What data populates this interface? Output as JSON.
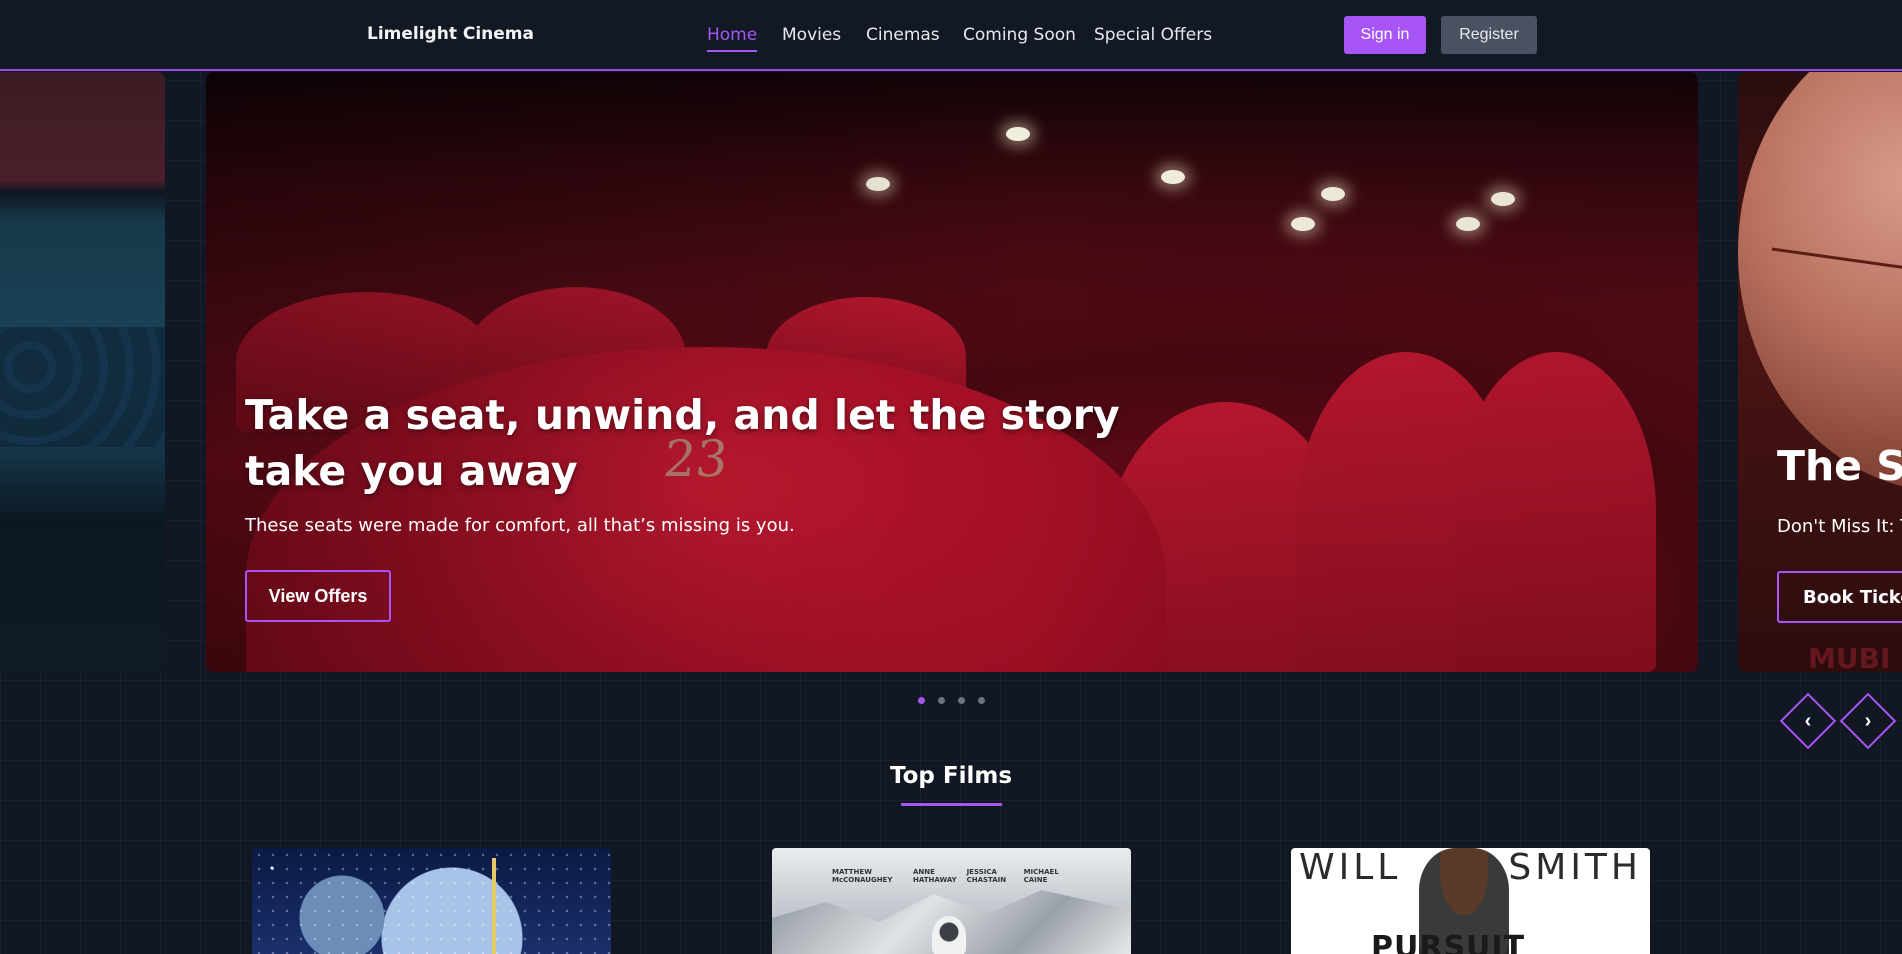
{
  "brand": "Limelight Cinema",
  "nav": {
    "items": [
      "Home",
      "Movies",
      "Cinemas",
      "Coming Soon",
      "Special Offers"
    ],
    "active": "Home"
  },
  "auth": {
    "signin": "Sign in",
    "register": "Register"
  },
  "hero": {
    "main": {
      "title": "Take a seat, unwind, and let the story take you away",
      "subtitle": "These seats were made for comfort, all that’s missing is you.",
      "button": "View Offers",
      "seat_number": "23"
    },
    "next": {
      "title_partial": "The Su",
      "subtitle_partial": "Don't Miss It: Th",
      "button_partial": "Book Ticket",
      "watermark": "MUBI"
    },
    "dots": 4,
    "active_dot": 1
  },
  "section": {
    "title": "Top Films"
  },
  "films": [
    {
      "poster": "star-wars-poster"
    },
    {
      "poster": "interstellar-poster",
      "credits": [
        "MATTHEW McCONAUGHEY",
        "ANNE HATHAWAY",
        "JESSICA CHASTAIN",
        "MICHAEL CAINE"
      ]
    },
    {
      "poster": "pursuit-of-happyness-poster",
      "top_left": "WILL",
      "top_right": "SMITH",
      "bottom": "PURSUIT"
    }
  ],
  "colors": {
    "accent": "#a855f7",
    "background": "#111723",
    "register_bg": "#4a5262"
  },
  "icons": {
    "prev": "chevron-left-icon",
    "next": "chevron-right-icon"
  }
}
